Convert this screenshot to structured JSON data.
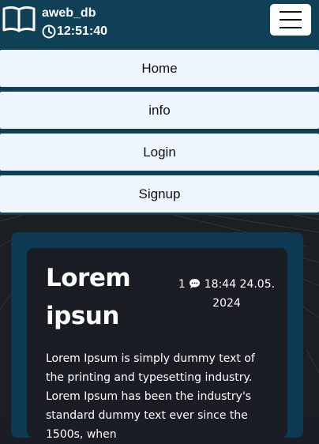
{
  "header": {
    "brand_name": "aweb_db",
    "clock_time": "12:51:40",
    "icons": {
      "brand": "book-icon",
      "clock": "clock-icon",
      "menu": "hamburger-menu-icon"
    }
  },
  "nav": {
    "items": [
      {
        "label": "Home"
      },
      {
        "label": "info"
      },
      {
        "label": "Login"
      },
      {
        "label": "Signup"
      }
    ]
  },
  "post": {
    "title": "Lorem ipsun",
    "comment_count": "1",
    "comment_icon": "comment-icon",
    "datetime": "18:44 24.05. 2024",
    "body": "Lorem Ipsum is simply dummy text of the printing and typesetting industry. Lorem Ipsum has been the industry's standard dummy text ever since the 1500s, when"
  },
  "colors": {
    "header_bg": "#0f4056",
    "nav_item_bg": "#eef5ff",
    "page_bg": "#1a1e24",
    "card_outer": "#0d3a52"
  }
}
